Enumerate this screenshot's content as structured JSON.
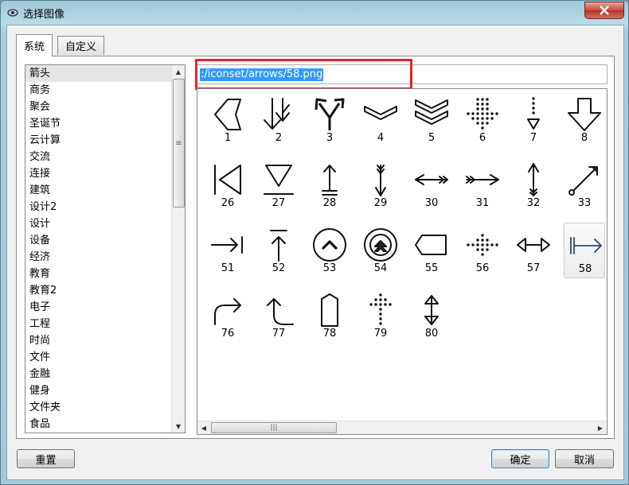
{
  "window": {
    "title": "选择图像",
    "close_icon": "close-x-icon",
    "title_icon": "eye-icon"
  },
  "tabs": [
    {
      "label": "系统",
      "active": true
    },
    {
      "label": "自定义",
      "active": false
    }
  ],
  "categories": [
    "箭头",
    "商务",
    "聚会",
    "圣诞节",
    "云计算",
    "交流",
    "连接",
    "建筑",
    "设计2",
    "设计",
    "设备",
    "经济",
    "教育",
    "教育2",
    "电子",
    "工程",
    "时尚",
    "文件",
    "金融",
    "健身",
    "文件夹",
    "食品"
  ],
  "selected_category": "箭头",
  "path_field": {
    "value": ":/iconset/arrows/58.png"
  },
  "icons": [
    {
      "label": "1",
      "icon": "chevron-arrow-left-icon"
    },
    {
      "label": "2",
      "icon": "double-down-arrow-icon"
    },
    {
      "label": "3",
      "icon": "split-arrow-icon"
    },
    {
      "label": "4",
      "icon": "chevron-down-icon"
    },
    {
      "label": "5",
      "icon": "double-chevron-down-icon"
    },
    {
      "label": "6",
      "icon": "dotted-down-arrow-icon"
    },
    {
      "label": "7",
      "icon": "dotted-line-down-arrow-icon"
    },
    {
      "label": "8",
      "icon": "outline-down-arrow-icon"
    },
    {
      "label": "26",
      "icon": "bar-left-triangle-icon"
    },
    {
      "label": "27",
      "icon": "triangle-down-bar-icon"
    },
    {
      "label": "28",
      "icon": "up-arrow-bar-icon"
    },
    {
      "label": "29",
      "icon": "arrow-feather-down-icon"
    },
    {
      "label": "30",
      "icon": "arrow-feather-left-icon"
    },
    {
      "label": "31",
      "icon": "arrow-feather-right-icon"
    },
    {
      "label": "32",
      "icon": "arrow-feather-up-icon"
    },
    {
      "label": "33",
      "icon": "arrow-diagonal-circle-icon"
    },
    {
      "label": "51",
      "icon": "right-arrow-to-bar-icon"
    },
    {
      "label": "52",
      "icon": "up-arrow-to-bar-icon"
    },
    {
      "label": "53",
      "icon": "circle-chevron-up-icon"
    },
    {
      "label": "54",
      "icon": "circle-double-chevron-up-icon"
    },
    {
      "label": "55",
      "icon": "tag-shape-icon"
    },
    {
      "label": "56",
      "icon": "dotted-right-arrow-icon"
    },
    {
      "label": "57",
      "icon": "left-right-arrow-icon"
    },
    {
      "label": "58",
      "icon": "bar-to-right-arrow-icon"
    },
    {
      "label": "76",
      "icon": "curved-right-arrow-icon"
    },
    {
      "label": "77",
      "icon": "curved-up-arrow-icon"
    },
    {
      "label": "78",
      "icon": "pentagon-up-icon"
    },
    {
      "label": "79",
      "icon": "dotted-up-arrow-icon"
    },
    {
      "label": "80",
      "icon": "up-down-arrow-icon"
    }
  ],
  "selected_icon": "58",
  "buttons": {
    "reset": "重置",
    "ok": "确定",
    "cancel": "取消"
  },
  "colors": {
    "accent": "#3399ff",
    "highlight_box": "#e0252b",
    "titlebar": "#b9dbe7",
    "selected_icon_stroke": "#2c4a6e"
  }
}
